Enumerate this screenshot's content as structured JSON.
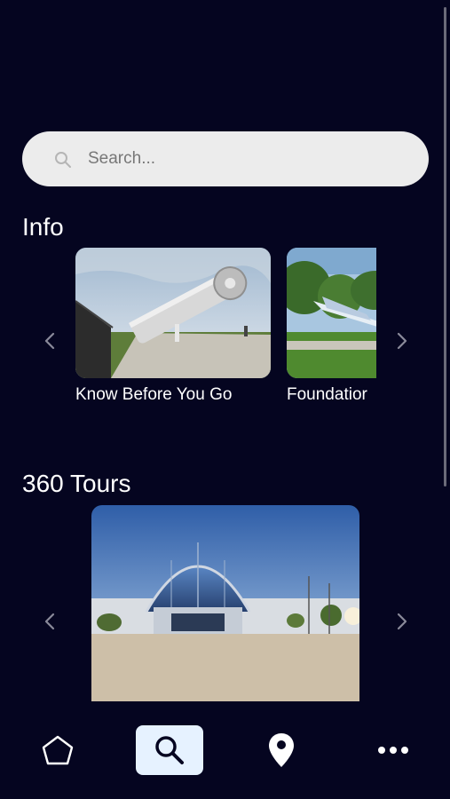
{
  "search": {
    "placeholder": "Search..."
  },
  "info": {
    "title": "Info",
    "cards": [
      {
        "label": "Know Before You Go"
      },
      {
        "label": "Foundatior"
      }
    ]
  },
  "tours": {
    "title": "360 Tours"
  },
  "nav": {
    "items": [
      {
        "icon": "home-icon"
      },
      {
        "icon": "search-icon",
        "active": true
      },
      {
        "icon": "location-pin-icon"
      },
      {
        "icon": "more-icon"
      }
    ]
  },
  "colors": {
    "background": "#050520",
    "search_bg": "#ececec",
    "active_nav_bg": "#e6f2ff"
  }
}
